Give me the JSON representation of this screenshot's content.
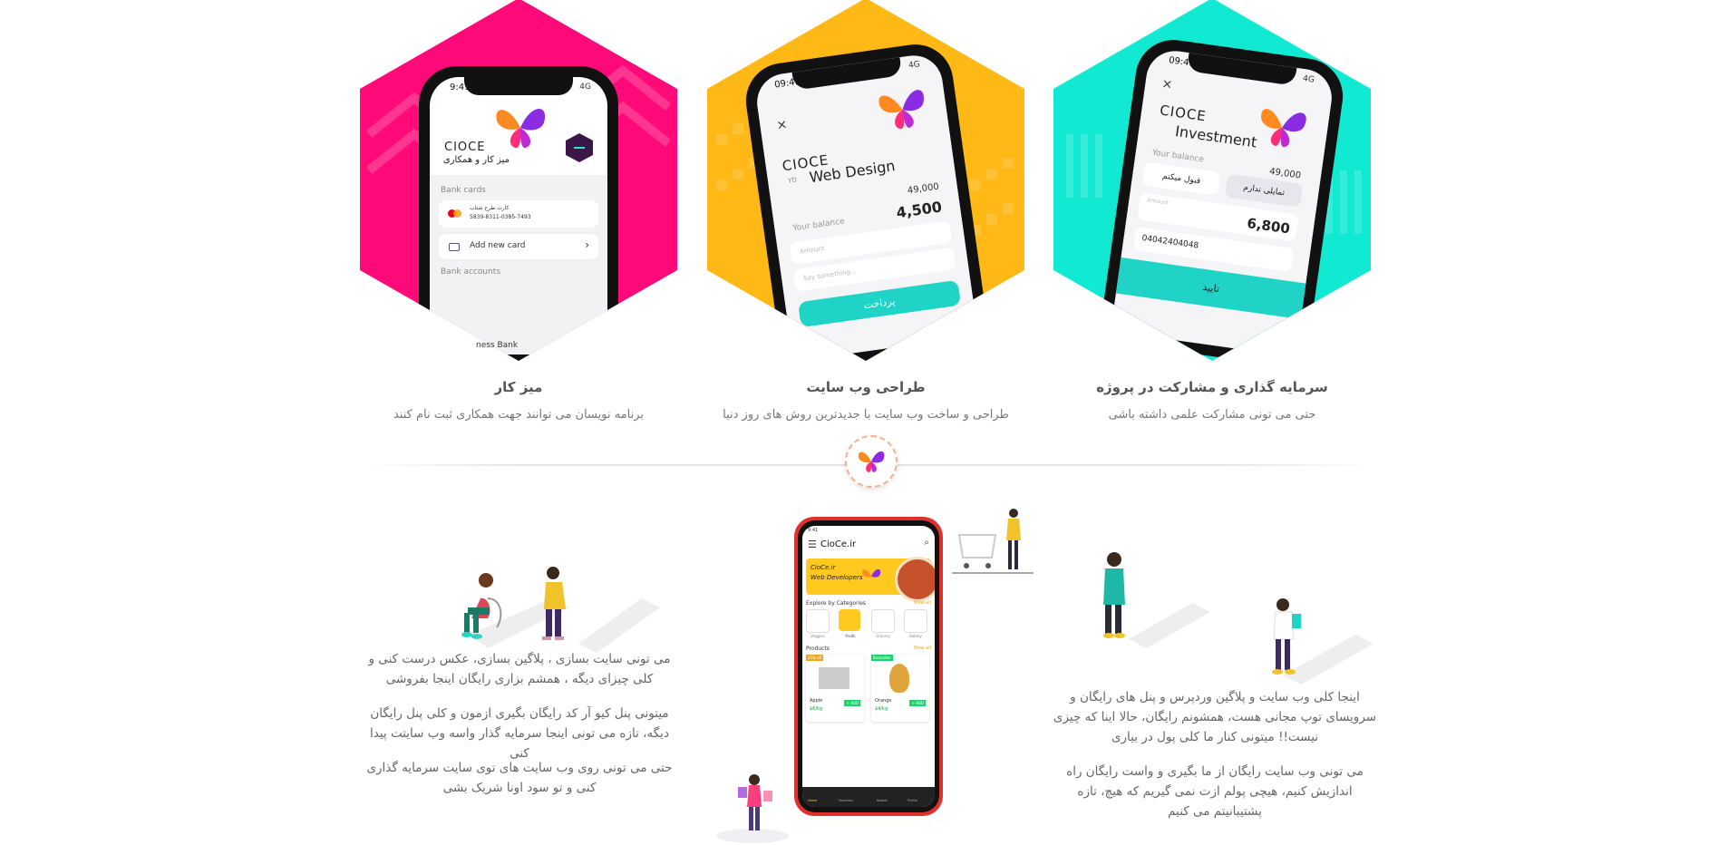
{
  "cards": [
    {
      "title": "میز کار",
      "subtitle": "برنامه نویسان می توانند جهت همکاری ثبت نام کنند",
      "phone": {
        "time": "9:41",
        "signal": "4G",
        "brand": "CIOCE",
        "brand_sub": "میز کار و همکاری",
        "section1": "Bank cards",
        "card_name": "کارت طرح شتاب",
        "card_number": "5839-8311-0385-7493",
        "add_card": "Add new card",
        "section2": "Bank accounts",
        "bank": "ness Bank"
      }
    },
    {
      "title": "طراحی وب سایت",
      "subtitle": "طراحی و ساخت وب سایت با جدیدترین روش های روز دنیا",
      "phone": {
        "time": "09:41",
        "signal": "4G",
        "brand": "CIOCE",
        "heading": "Web Design",
        "amount_top": "49,000",
        "balance_label": "Your balance",
        "balance": "4,500",
        "field1_placeholder": "Amount",
        "field2_placeholder": "Say something...",
        "pay_button": "پرداخت",
        "close": "×",
        "currency": "YD"
      }
    },
    {
      "title": "سرمایه گذاری و مشارکت در پروژه",
      "subtitle": "حتی می تونی مشارکت علمی داشته باشی",
      "phone": {
        "time": "09:41",
        "signal": "4G",
        "brand": "CIOCE",
        "heading": "Investment",
        "balance_label": "Your balance",
        "amount_top": "49,000",
        "accept": "قبول میکنم",
        "decline": "تمایلی ندارم",
        "amount_label": "Amount",
        "balance": "6,800",
        "input_value": "04042404048",
        "confirm_button": "تایید",
        "close": "×"
      }
    }
  ],
  "left_paragraphs": [
    "می تونی سایت بسازی ، پلاگین بسازی، عکس درست کنی و کلی چیزای دیگه ، همشم بزاری رایگان اینجا بفروشی",
    "میتونی پنل کیو آر کد رایگان بگیری ازمون و کلی پنل رایگان دیگه، تازه می تونی اینجا سرمایه گذار واسه وب سایتت پیدا کنی",
    "حتی می تونی روی وب سایت های توی سایت سرمایه گذاری کنی و تو سود اونا شریک بشی"
  ],
  "right_paragraphs": [
    "اینجا کلی وب سایت و پلاگین وردپرس و پنل های رایگان و سرویسای توپ مجانی هست، همشونم رایگان، حالا اینا که چیزی نیست!! میتونی کنار ما کلی پول در بیاری",
    "می تونی وب سایت رایگان از ما بگیری و واست رایگان راه اندازیش کنیم، هیچی پولم ازت نمی گیریم که هیچ، تازه پشتیبانیتم می کنیم"
  ],
  "center_phone": {
    "time": "9:41",
    "site": "CioCe.ir",
    "banner_line1": "CioCe.ir",
    "banner_line2": "Web Developers",
    "explore": "Explore by Categories",
    "view_all": "View all",
    "categories": [
      "Veggies",
      "Fruits",
      "Grocery",
      "Bakery"
    ],
    "products_title": "Products",
    "products": [
      {
        "badge": "25% off",
        "name": "Apple",
        "price": "$6/kg",
        "add": "+ ADD"
      },
      {
        "badge": "Bestseller",
        "name": "Orange",
        "price": "$4/kg",
        "add": "+ ADD"
      }
    ],
    "nav": [
      "Home",
      "Favorites",
      "Basket",
      "Profile"
    ]
  },
  "colors": {
    "pink": "#ff0a78",
    "yellow": "#ffb916",
    "teal": "#12e9d2",
    "accent_teal": "#1fd3c6"
  }
}
